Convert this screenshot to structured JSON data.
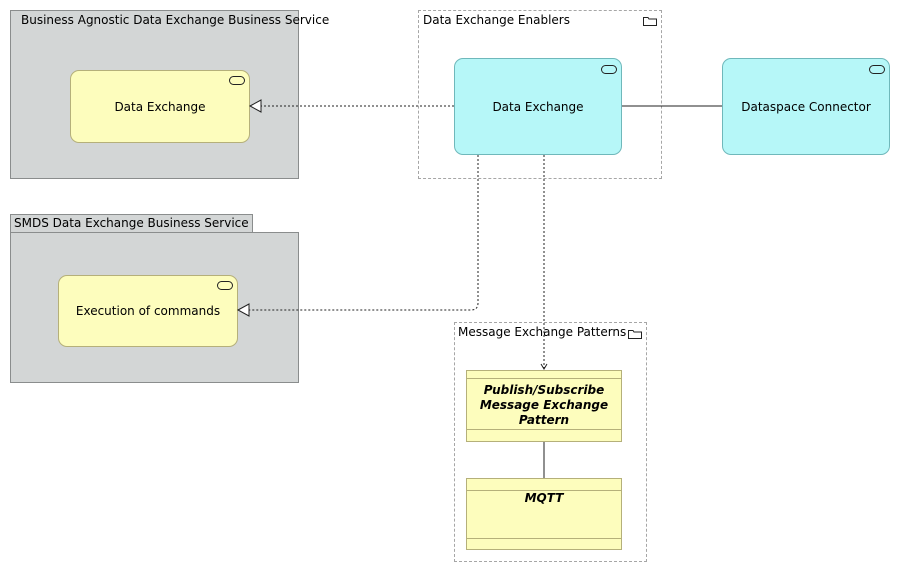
{
  "groups": {
    "business_agnostic": {
      "label": "Business Agnostic Data Exchange Business Service"
    },
    "smds": {
      "label": "SMDS Data Exchange Business Service"
    },
    "enablers": {
      "label": "Data Exchange Enablers"
    },
    "patterns": {
      "label": "Message Exchange Patterns"
    }
  },
  "services": {
    "agnostic_data_exchange": "Data Exchange",
    "execution_of_commands": "Execution of commands",
    "enabler_data_exchange": "Data Exchange",
    "dataspace_connector": "Dataspace Connector"
  },
  "classes": {
    "pubsub": {
      "line1": "Publish/Subscribe",
      "line2": "Message Exchange Pattern"
    },
    "mqtt": {
      "title": "MQTT"
    }
  },
  "colors": {
    "group_gray": "#d3d6d6",
    "service_yellow": "#fdfdbd",
    "service_cyan": "#b6f7f8",
    "dashed_border": "#a6a6a6"
  },
  "icons": {
    "service": "service-pill-icon",
    "group": "folder-icon"
  }
}
